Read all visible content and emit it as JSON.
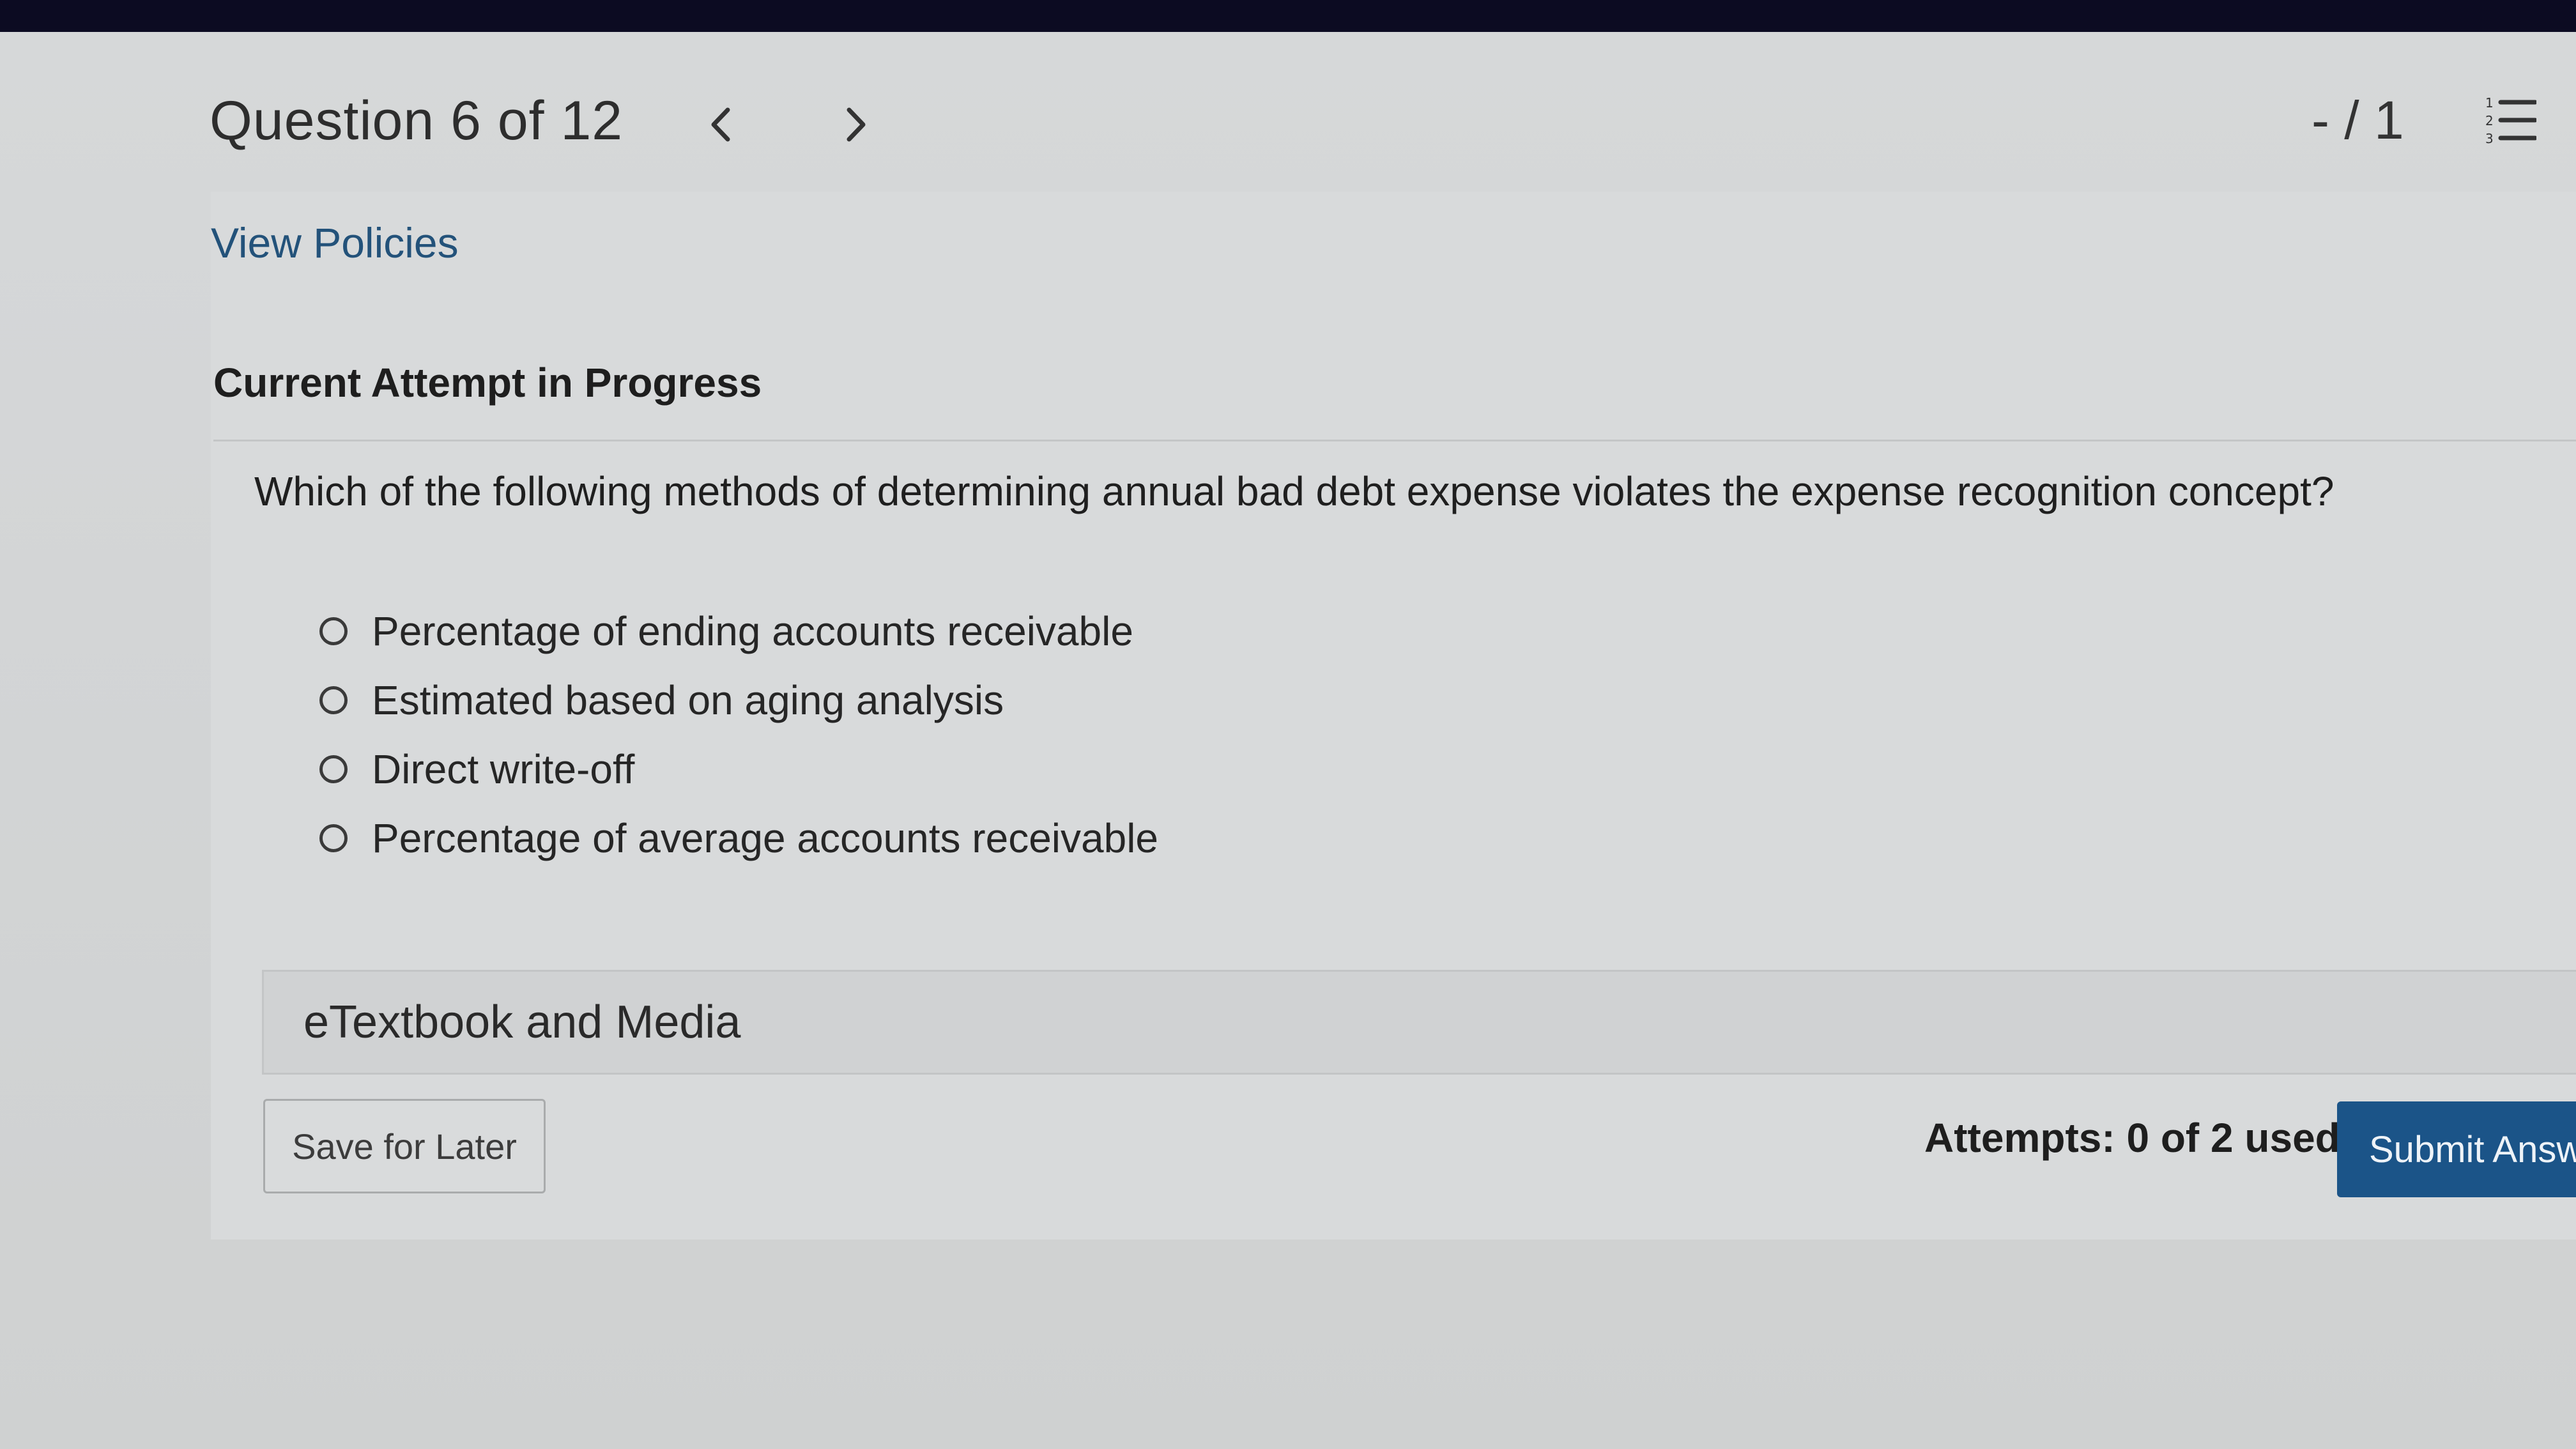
{
  "header": {
    "question_title": "Question 6 of 12",
    "score": "- / 1",
    "prev_icon": "chevron-left-icon",
    "next_icon": "chevron-right-icon",
    "list_icon": "numbered-list-icon"
  },
  "links": {
    "view_policies": "View Policies"
  },
  "attempt": {
    "heading": "Current Attempt in Progress"
  },
  "question": {
    "text": "Which of the following methods of determining annual bad debt expense violates the expense recognition concept?",
    "options": [
      {
        "label": "Percentage of ending accounts receivable",
        "selected": false
      },
      {
        "label": "Estimated based on aging analysis",
        "selected": false
      },
      {
        "label": "Direct write-off",
        "selected": false
      },
      {
        "label": "Percentage of average accounts receivable",
        "selected": false
      }
    ]
  },
  "resources": {
    "etextbook_label": "eTextbook and Media"
  },
  "footer": {
    "save_label": "Save for Later",
    "attempts_text": "Attempts: 0 of 2 used",
    "submit_label": "Submit Answer"
  },
  "colors": {
    "link": "#23527a",
    "submit_bg": "#1b5488",
    "bezel": "#0c0b22"
  }
}
